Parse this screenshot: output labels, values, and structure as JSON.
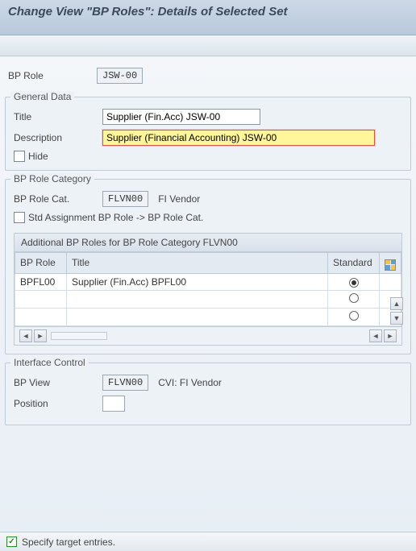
{
  "header": {
    "title": "Change View \"BP Roles\": Details of Selected Set"
  },
  "top": {
    "bp_role_label": "BP Role",
    "bp_role_value": "JSW-00"
  },
  "general_data": {
    "legend": "General Data",
    "title_label": "Title",
    "title_value": "Supplier (Fin.Acc) JSW-00",
    "description_label": "Description",
    "description_value": "Supplier (Financial Accounting) JSW-00",
    "hide_label": "Hide",
    "hide_checked": false
  },
  "role_category": {
    "legend": "BP Role Category",
    "bp_role_cat_label": "BP Role Cat.",
    "bp_role_cat_value": "FLVN00",
    "bp_role_cat_text": "FI Vendor",
    "std_assignment_label": "Std Assignment BP Role -> BP Role Cat.",
    "std_assignment_checked": false,
    "inner_title": "Additional BP Roles for BP Role Category FLVN00",
    "columns": {
      "bp_role": "BP Role",
      "title": "Title",
      "standard": "Standard"
    },
    "rows": [
      {
        "bp_role": "BPFL00",
        "title": "Supplier (Fin.Acc) BPFL00",
        "standard": true
      },
      {
        "bp_role": "",
        "title": "",
        "standard": false
      },
      {
        "bp_role": "",
        "title": "",
        "standard": false
      }
    ]
  },
  "interface_control": {
    "legend": "Interface Control",
    "bp_view_label": "BP View",
    "bp_view_value": "FLVN00",
    "bp_view_text": "CVI: FI Vendor",
    "position_label": "Position",
    "position_value": ""
  },
  "status": {
    "message": "Specify target entries."
  }
}
